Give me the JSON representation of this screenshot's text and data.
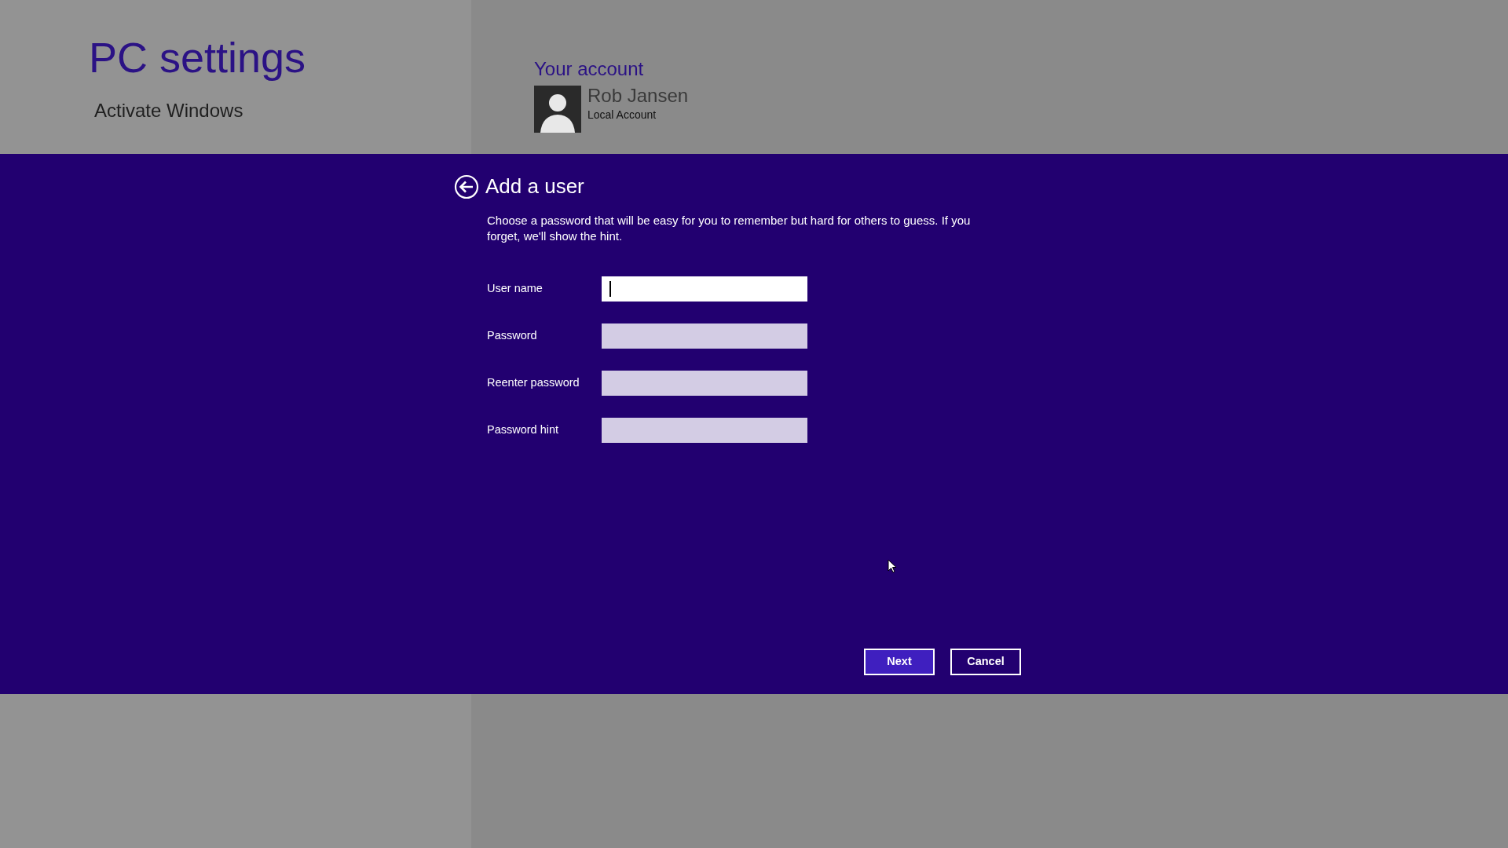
{
  "settings": {
    "title": "PC settings",
    "nav_items": [
      {
        "label": "Activate Windows"
      }
    ]
  },
  "account": {
    "heading": "Your account",
    "name": "Rob Jansen",
    "type": "Local Account"
  },
  "dialog": {
    "title": "Add a user",
    "description": "Choose a password that will be easy for you to remember but hard for others to guess. If you forget, we'll show the hint.",
    "fields": [
      {
        "label": "User name",
        "focused": true
      },
      {
        "label": "Password",
        "focused": false
      },
      {
        "label": "Reenter password",
        "focused": false
      },
      {
        "label": "Password hint",
        "focused": false
      }
    ],
    "buttons": [
      {
        "label": "Next",
        "primary": true
      },
      {
        "label": "Cancel",
        "primary": false
      }
    ]
  }
}
